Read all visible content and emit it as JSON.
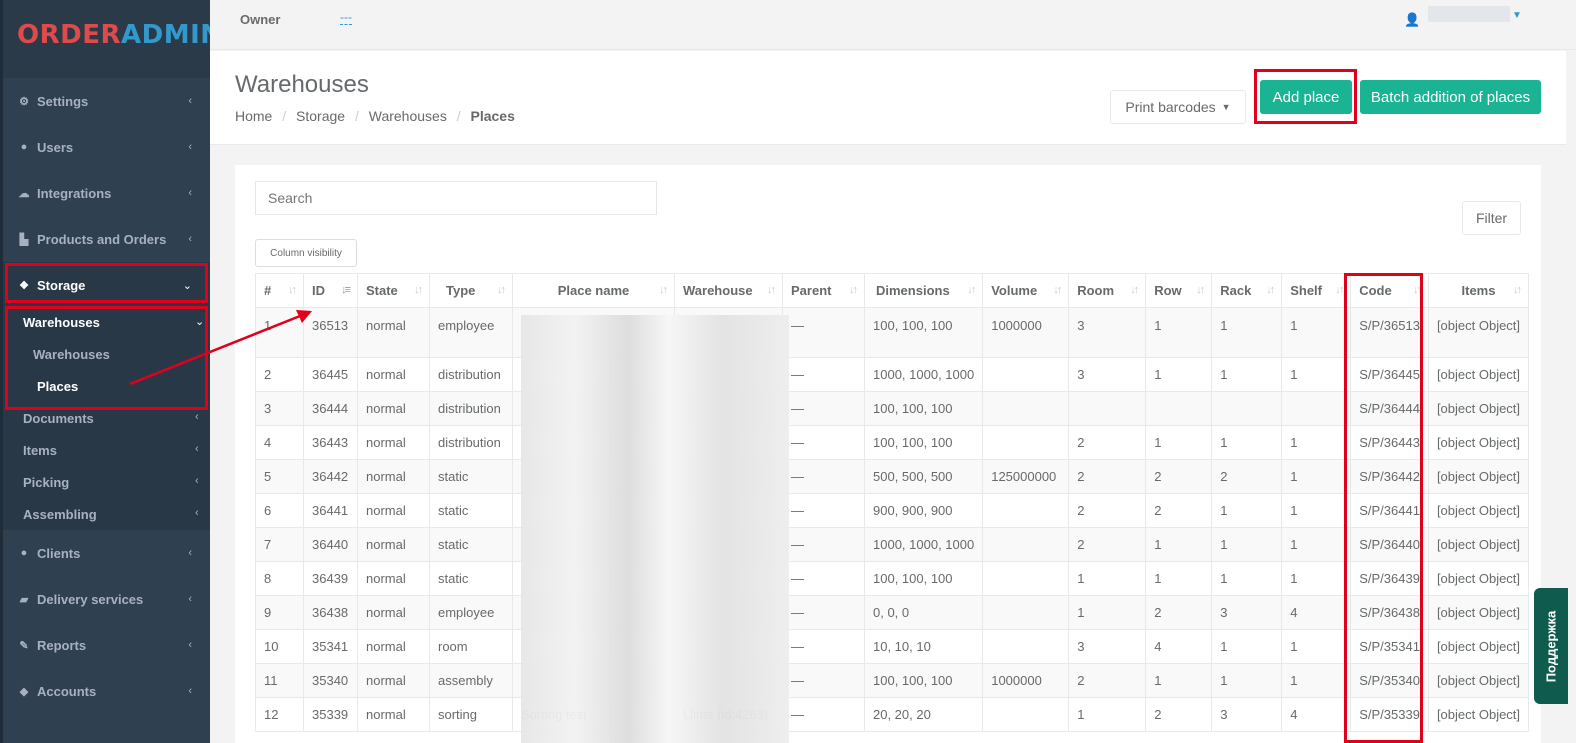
{
  "app": {
    "logo_part1": "ORDER",
    "logo_part2": "ADMIN"
  },
  "topbar": {
    "owner_label": "Owner",
    "owner_value": "---"
  },
  "sidebar": {
    "items": [
      {
        "label": "Settings",
        "icon": "gear-icon"
      },
      {
        "label": "Users",
        "icon": "user-icon"
      },
      {
        "label": "Integrations",
        "icon": "cloud-icon"
      },
      {
        "label": "Products and Orders",
        "icon": "cart-icon"
      },
      {
        "label": "Storage",
        "icon": "cubes-icon"
      },
      {
        "label": "Clients",
        "icon": "users-icon"
      },
      {
        "label": "Delivery services",
        "icon": "truck-icon"
      },
      {
        "label": "Reports",
        "icon": "paperclip-icon"
      },
      {
        "label": "Accounts",
        "icon": "piggy-bank-icon"
      }
    ],
    "storage_sub": [
      {
        "label": "Warehouses"
      },
      {
        "label": "Documents"
      },
      {
        "label": "Items"
      },
      {
        "label": "Picking"
      },
      {
        "label": "Assembling"
      }
    ],
    "warehouses_sub": [
      {
        "label": "Warehouses"
      },
      {
        "label": "Places"
      }
    ]
  },
  "header": {
    "title": "Warehouses",
    "breadcrumb": [
      "Home",
      "Storage",
      "Warehouses",
      "Places"
    ],
    "print_barcodes": "Print barcodes",
    "add_place": "Add place",
    "batch_add": "Batch addition of places"
  },
  "content": {
    "search_placeholder": "Search",
    "filter_label": "Filter",
    "column_visibility": "Column visibility"
  },
  "table": {
    "columns": [
      "#",
      "ID",
      "State",
      "Type",
      "Place name",
      "Warehouse",
      "Parent",
      "Dimensions",
      "Volume",
      "Room",
      "Row",
      "Rack",
      "Shelf",
      "Code",
      "Items"
    ],
    "rows": [
      {
        "n": "1",
        "id": "36513",
        "state": "normal",
        "type": "employee",
        "place": "",
        "wh": "",
        "parent": "—",
        "dim": "100, 100, 100",
        "vol": "1000000",
        "room": "3",
        "row": "1",
        "rack": "1",
        "shelf": "1",
        "code": "S/P/36513",
        "items": "[object Object]"
      },
      {
        "n": "2",
        "id": "36445",
        "state": "normal",
        "type": "distribution",
        "place": "",
        "wh": "",
        "parent": "—",
        "dim": "1000, 1000, 1000",
        "vol": "",
        "room": "3",
        "row": "1",
        "rack": "1",
        "shelf": "1",
        "code": "S/P/36445",
        "items": "[object Object]"
      },
      {
        "n": "3",
        "id": "36444",
        "state": "normal",
        "type": "distribution",
        "place": "",
        "wh": "",
        "parent": "—",
        "dim": "100, 100, 100",
        "vol": "",
        "room": "",
        "row": "",
        "rack": "",
        "shelf": "",
        "code": "S/P/36444",
        "items": "[object Object]"
      },
      {
        "n": "4",
        "id": "36443",
        "state": "normal",
        "type": "distribution",
        "place": "",
        "wh": "",
        "parent": "—",
        "dim": "100, 100, 100",
        "vol": "",
        "room": "2",
        "row": "1",
        "rack": "1",
        "shelf": "1",
        "code": "S/P/36443",
        "items": "[object Object]"
      },
      {
        "n": "5",
        "id": "36442",
        "state": "normal",
        "type": "static",
        "place": "",
        "wh": "",
        "parent": "—",
        "dim": "500, 500, 500",
        "vol": "125000000",
        "room": "2",
        "row": "2",
        "rack": "2",
        "shelf": "1",
        "code": "S/P/36442",
        "items": "[object Object]"
      },
      {
        "n": "6",
        "id": "36441",
        "state": "normal",
        "type": "static",
        "place": "",
        "wh": "",
        "parent": "—",
        "dim": "900, 900, 900",
        "vol": "",
        "room": "2",
        "row": "2",
        "rack": "1",
        "shelf": "1",
        "code": "S/P/36441",
        "items": "[object Object]"
      },
      {
        "n": "7",
        "id": "36440",
        "state": "normal",
        "type": "static",
        "place": "",
        "wh": "",
        "parent": "—",
        "dim": "1000, 1000, 1000",
        "vol": "",
        "room": "2",
        "row": "1",
        "rack": "1",
        "shelf": "1",
        "code": "S/P/36440",
        "items": "[object Object]"
      },
      {
        "n": "8",
        "id": "36439",
        "state": "normal",
        "type": "static",
        "place": "",
        "wh": "",
        "parent": "—",
        "dim": "100, 100, 100",
        "vol": "",
        "room": "1",
        "row": "1",
        "rack": "1",
        "shelf": "1",
        "code": "S/P/36439",
        "items": "[object Object]"
      },
      {
        "n": "9",
        "id": "36438",
        "state": "normal",
        "type": "employee",
        "place": "",
        "wh": "",
        "parent": "—",
        "dim": "0, 0, 0",
        "vol": "",
        "room": "1",
        "row": "2",
        "rack": "3",
        "shelf": "4",
        "code": "S/P/36438",
        "items": "[object Object]"
      },
      {
        "n": "10",
        "id": "35341",
        "state": "normal",
        "type": "room",
        "place": "",
        "wh": "",
        "parent": "—",
        "dim": "10, 10, 10",
        "vol": "",
        "room": "3",
        "row": "4",
        "rack": "1",
        "shelf": "1",
        "code": "S/P/35341",
        "items": "[object Object]"
      },
      {
        "n": "11",
        "id": "35340",
        "state": "normal",
        "type": "assembly",
        "place": "",
        "wh": "",
        "parent": "—",
        "dim": "100, 100, 100",
        "vol": "1000000",
        "room": "2",
        "row": "1",
        "rack": "1",
        "shelf": "1",
        "code": "S/P/35340",
        "items": "[object Object]"
      },
      {
        "n": "12",
        "id": "35339",
        "state": "normal",
        "type": "sorting",
        "place": "Sorting test",
        "wh": "Llims (id:4263)",
        "parent": "—",
        "dim": "20, 20, 20",
        "vol": "",
        "room": "1",
        "row": "2",
        "rack": "3",
        "shelf": "4",
        "code": "S/P/35339",
        "items": "[object Object]"
      }
    ]
  },
  "support": {
    "label": "Поддержка"
  },
  "colors": {
    "accent": "#1ab394",
    "sidebar_bg": "#2f4050",
    "highlight": "#e0001b"
  }
}
